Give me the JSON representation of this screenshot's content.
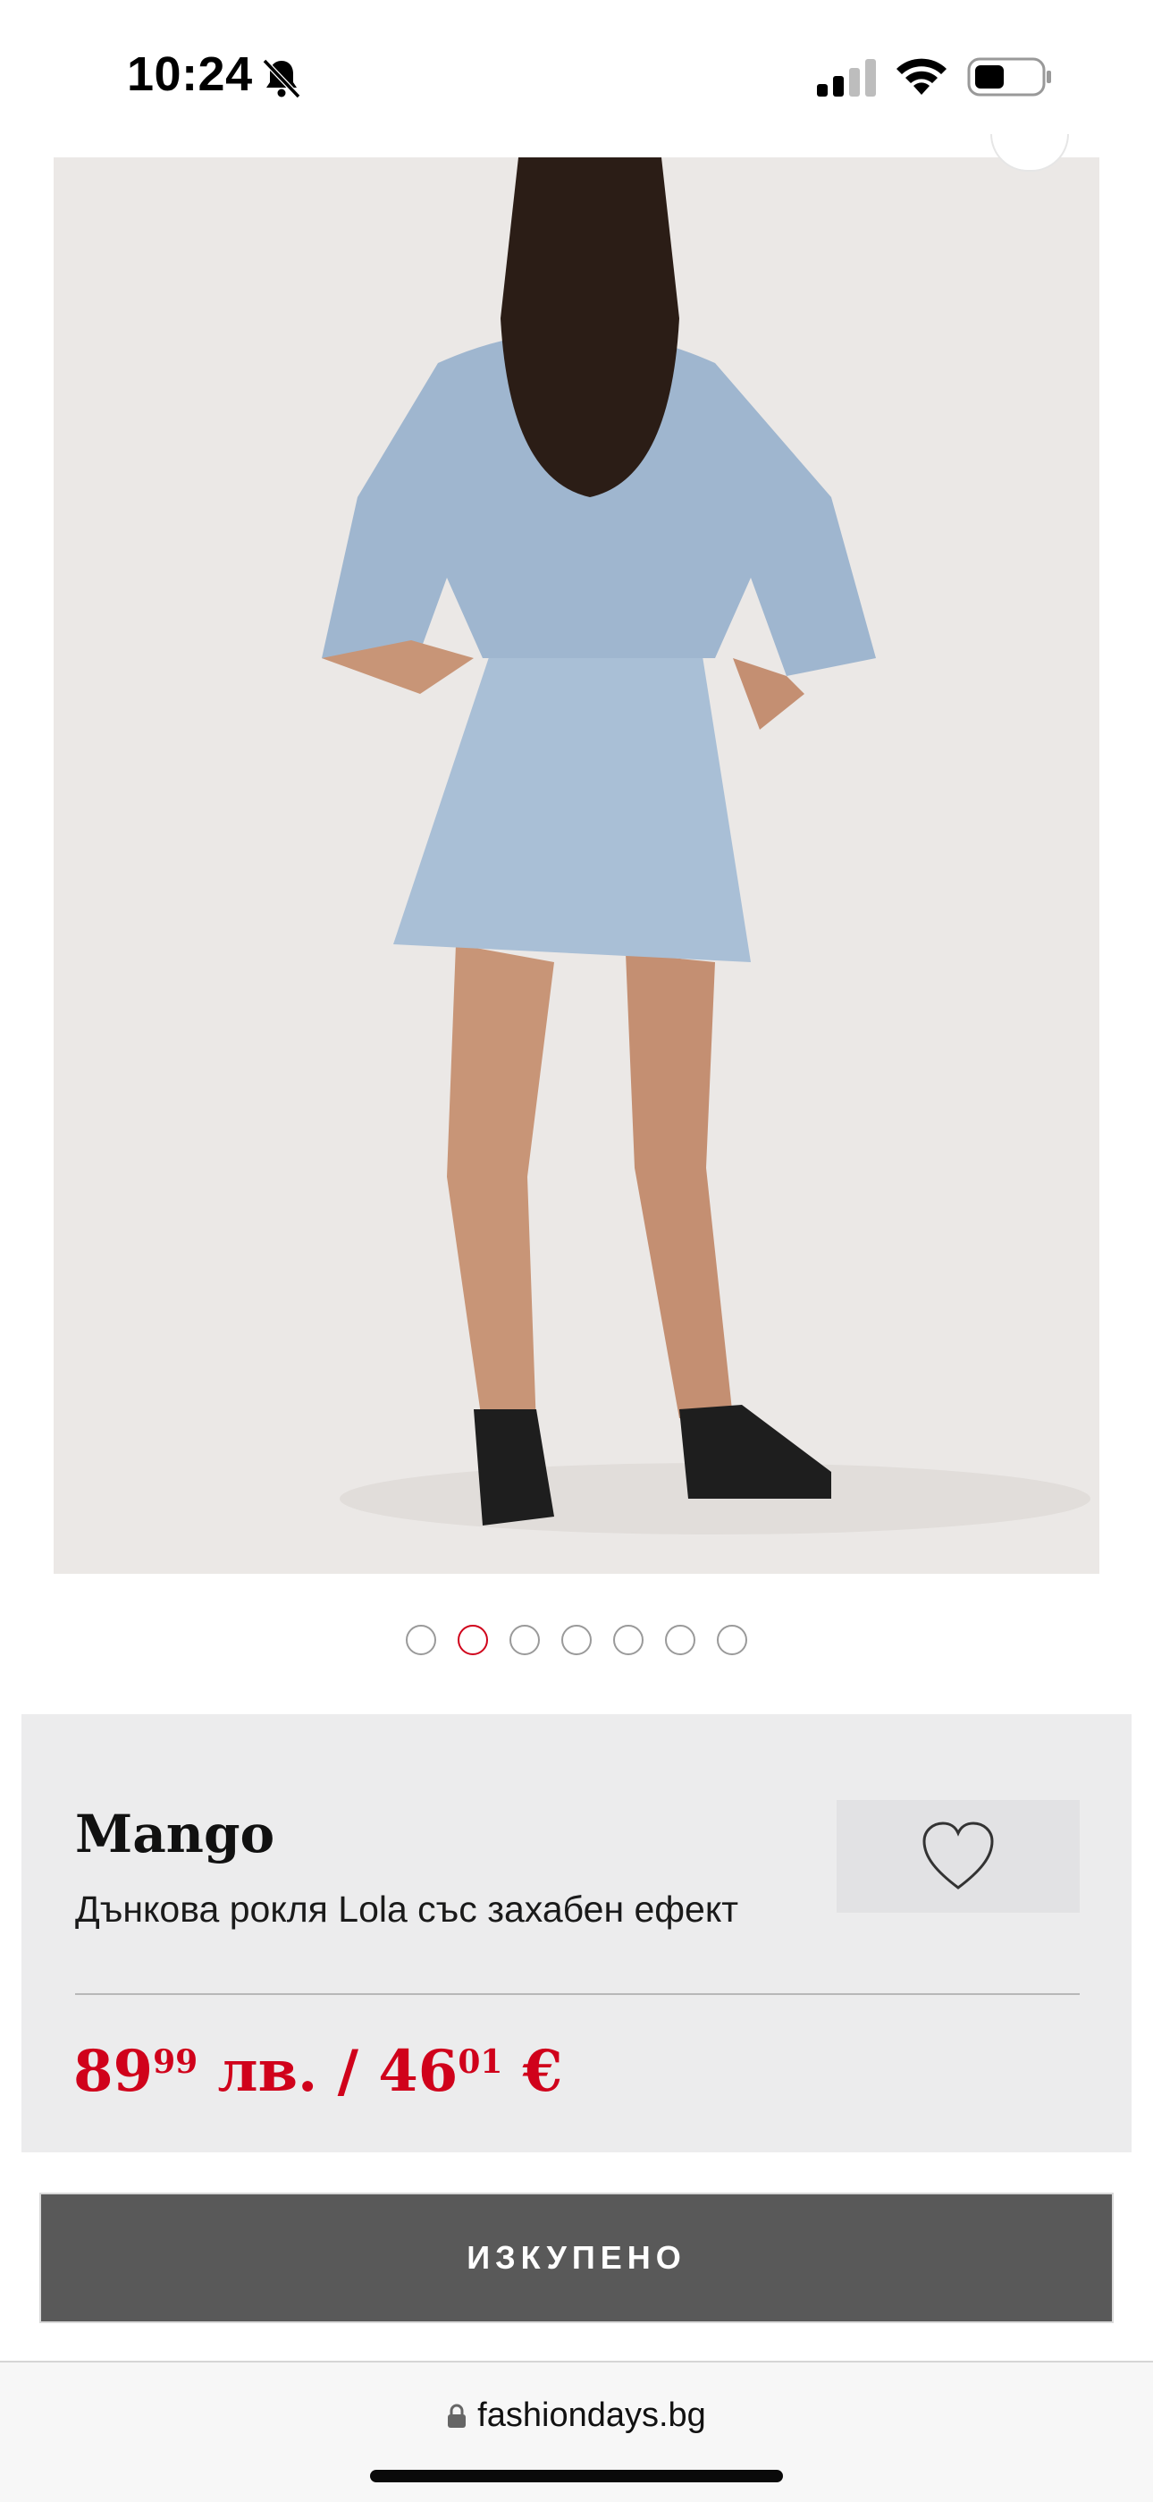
{
  "status_bar": {
    "time": "10:24",
    "icons": [
      "bell-slash-icon",
      "cellular-signal-icon",
      "wifi-icon",
      "battery-icon"
    ]
  },
  "carousel": {
    "total_slides": 7,
    "active_index": 1
  },
  "product": {
    "brand": "Mango",
    "name": "Дънкова рокля Lola със захабен ефект",
    "price_bgn_whole": "89",
    "price_bgn_cents": "99",
    "price_bgn_currency": "лв.",
    "price_separator": "/",
    "price_eur_whole": "46",
    "price_eur_cents": "01",
    "price_eur_currency": "€",
    "wishlist_icon": "heart-icon"
  },
  "cta": {
    "label": "ИЗКУПЕНО"
  },
  "browser": {
    "url": "fashiondays.bg",
    "lock_icon": "lock-icon"
  },
  "colors": {
    "accent_red": "#d0021b",
    "panel_bg": "#ececed",
    "button_bg": "#595959"
  }
}
